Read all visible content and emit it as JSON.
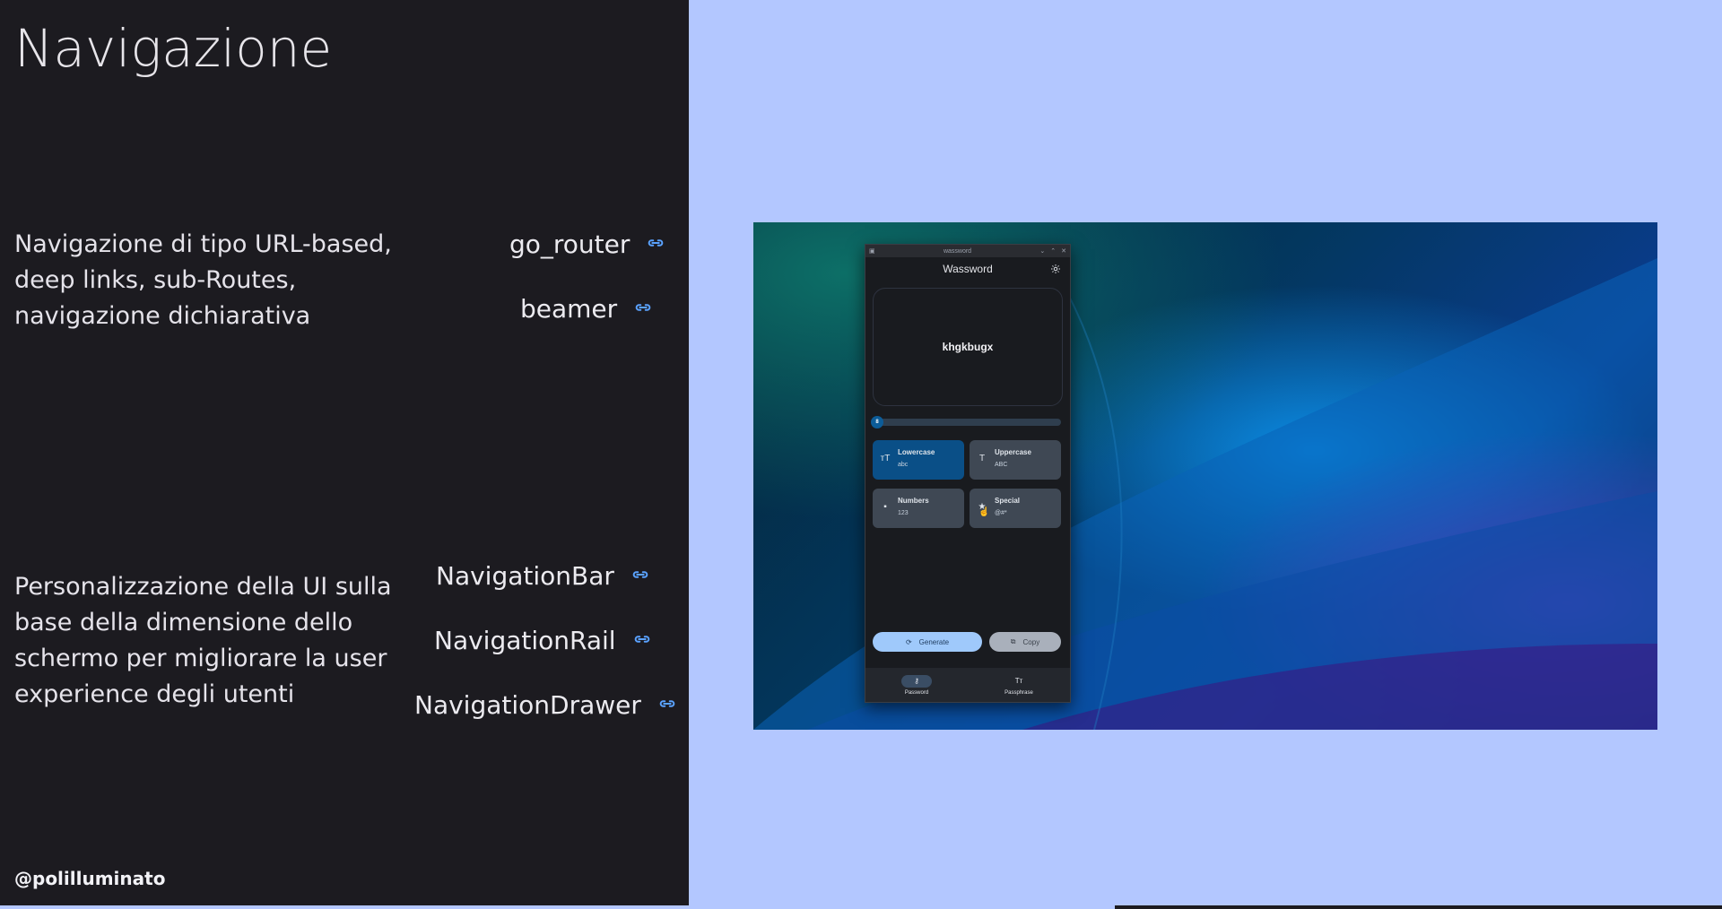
{
  "slide": {
    "title": "Navigazione",
    "paragraph1": "Navigazione di tipo URL-based, deep links, sub-Routes, navigazione dichiarativa",
    "paragraph2": "Personalizzazione della UI sulla base della dimensione dello schermo per migliorare la user experience degli utenti",
    "links1": [
      "go_router",
      "beamer"
    ],
    "links2": [
      "NavigationBar",
      "NavigationRail",
      "NavigationDrawer"
    ],
    "handle": "@polilluminato"
  },
  "app": {
    "window_title": "wassword",
    "header_title": "Wassword",
    "password": "khgkbugx",
    "length": "8",
    "length_fraction": 0.02,
    "options": [
      {
        "label": "Lowercase",
        "sub": "abc",
        "icon": "lowercase-icon",
        "active": true
      },
      {
        "label": "Uppercase",
        "sub": "ABC",
        "icon": "uppercase-icon",
        "active": false
      },
      {
        "label": "Numbers",
        "sub": "123",
        "icon": "numbers-icon",
        "active": false
      },
      {
        "label": "Special",
        "sub": "@#*",
        "icon": "star-icon",
        "active": false
      }
    ],
    "generate_label": "Generate",
    "copy_label": "Copy",
    "nav": {
      "password": "Password",
      "passphrase": "Passphrase"
    }
  },
  "colors": {
    "left_bg": "#1c1b20",
    "right_bg": "#b3c7ff",
    "link_icon": "#5aa2ff",
    "chip_active": "#0a4f87",
    "generate_button": "#9fc9fb"
  }
}
